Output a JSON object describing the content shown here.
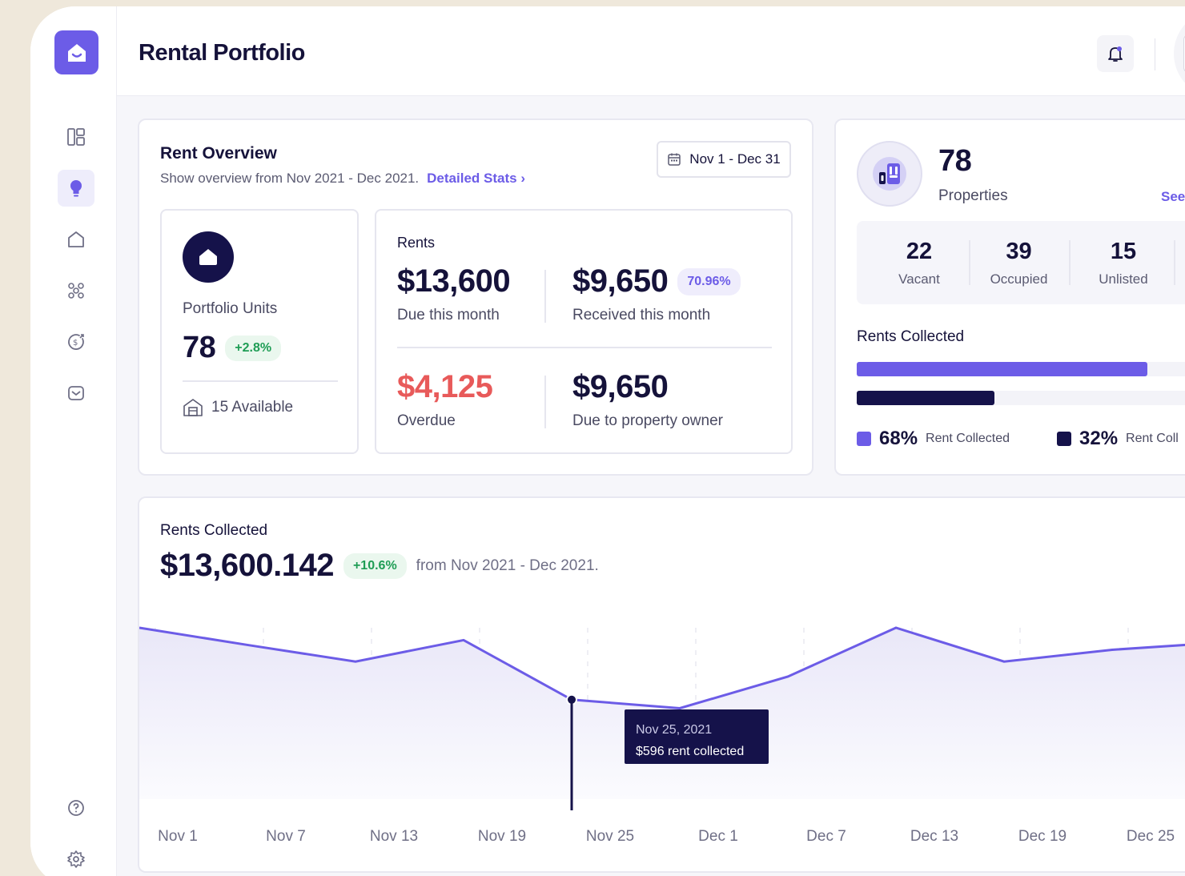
{
  "page": {
    "title": "Rental Portfolio"
  },
  "sidebar": {
    "items": [
      {
        "icon": "dashboard-icon"
      },
      {
        "icon": "lightbulb-icon",
        "active": true
      },
      {
        "icon": "home-icon"
      },
      {
        "icon": "people-icon"
      },
      {
        "icon": "money-icon"
      },
      {
        "icon": "mail-icon"
      }
    ],
    "bottom": [
      {
        "icon": "help-icon"
      },
      {
        "icon": "settings-icon"
      }
    ]
  },
  "overview": {
    "title": "Rent Overview",
    "subtitle": "Show overview from Nov 2021 - Dec 2021.",
    "link": "Detailed Stats",
    "date_range": "Nov 1 - Dec 31",
    "units": {
      "label": "Portfolio Units",
      "value": "78",
      "change": "+2.8%",
      "available": "15 Available"
    },
    "rents": {
      "label": "Rents",
      "due_value": "$13,600",
      "due_label": "Due this month",
      "received_value": "$9,650",
      "received_pct": "70.96%",
      "received_label": "Received this month",
      "overdue_value": "$4,125",
      "overdue_label": "Overdue",
      "owner_value": "$9,650",
      "owner_label": "Due to property owner"
    }
  },
  "properties": {
    "count": "78",
    "label": "Properties",
    "see_link": "See",
    "stats": [
      {
        "value": "22",
        "label": "Vacant"
      },
      {
        "value": "39",
        "label": "Occupied"
      },
      {
        "value": "15",
        "label": "Unlisted"
      }
    ],
    "rents_title": "Rents Collected",
    "bar1_fraction": 0.68,
    "bar2_fraction": 0.32,
    "legend": [
      {
        "pct": "68%",
        "label": "Rent Collected",
        "color": "#6c5ce7"
      },
      {
        "pct": "32%",
        "label": "Rent Coll",
        "color": "#15124a"
      }
    ]
  },
  "collected": {
    "title": "Rents Collected",
    "total": "$13,600.142",
    "change": "+10.6%",
    "range": "from Nov 2021 - Dec 2021.",
    "tooltip_date": "Nov 25, 2021",
    "tooltip_value": "$596",
    "tooltip_text": "rent collected"
  },
  "chart_data": {
    "type": "area",
    "x_labels": [
      "Nov 1",
      "Nov 7",
      "Nov 13",
      "Nov 19",
      "Nov 25",
      "Dec 1",
      "Dec 7",
      "Dec 13",
      "Dec 19",
      "Dec 25"
    ],
    "values": [
      1000,
      968,
      937,
      977,
      866,
      850,
      909,
      1000,
      937,
      959
    ],
    "highlight_index": 4,
    "highlight_value": 596,
    "colors": {
      "line": "#6c5ce7",
      "marker": "#15124a"
    }
  }
}
